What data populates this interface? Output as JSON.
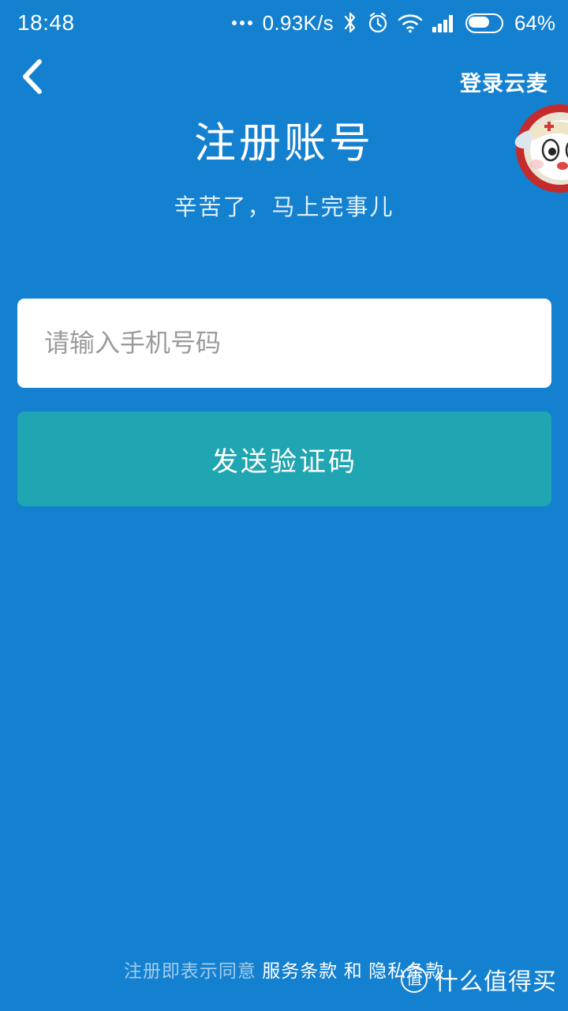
{
  "theme": {
    "background": "#1480d0",
    "button": "#20a5b2",
    "field_background": "#ffffff",
    "text_on_primary": "#ffffff"
  },
  "status_bar": {
    "time": "18:48",
    "more_dots": "•••",
    "network_speed": "0.93K/s",
    "bluetooth_icon": "bluetooth-icon",
    "alarm_icon": "alarm-clock-icon",
    "wifi_icon": "wifi-icon",
    "signal_icon": "cellular-signal-icon",
    "battery_icon": "battery-icon",
    "battery_percent": "64%"
  },
  "navbar": {
    "back_icon": "chevron-left-icon",
    "login_link": "登录云麦"
  },
  "header": {
    "title": "注册账号",
    "subtitle": "辛苦了，马上完事儿",
    "mascot": "bunny-mascot-icon"
  },
  "form": {
    "phone": {
      "value": "",
      "placeholder": "请输入手机号码"
    },
    "send_code_button": "发送验证码"
  },
  "footer": {
    "agreement_prefix": "注册即表示同意",
    "terms_link": "服务条款",
    "conjunction": "和",
    "privacy_link": "隐私条款"
  },
  "watermark": {
    "logo_text": "值",
    "label": "什么值得买"
  }
}
